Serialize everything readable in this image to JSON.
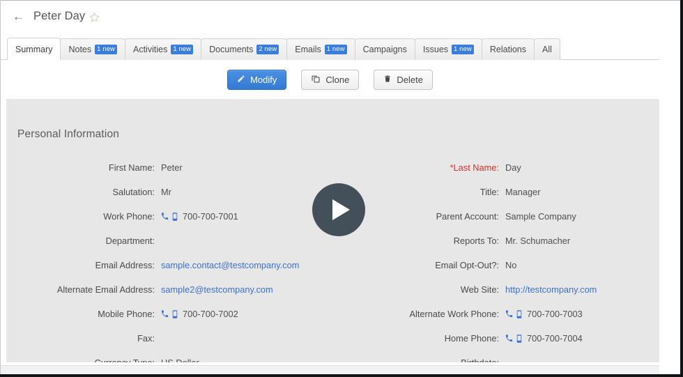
{
  "window": {
    "frame_color": "#111315",
    "background": "#ffffff"
  },
  "header": {
    "back_icon": "back-arrow-icon",
    "back_glyph": "←",
    "title": "Peter Day",
    "favorite_icon": "star-outline-icon",
    "star_color": "#d8cfc2"
  },
  "tabs": {
    "active": "Summary",
    "items": [
      {
        "label": "Summary",
        "badge": "",
        "active": true
      },
      {
        "label": "Notes",
        "badge": "1 new",
        "active": false
      },
      {
        "label": "Activities",
        "badge": "1 new",
        "active": false
      },
      {
        "label": "Documents",
        "badge": "2 new",
        "active": false
      },
      {
        "label": "Emails",
        "badge": "1 new",
        "active": false
      },
      {
        "label": "Campaigns",
        "badge": "",
        "active": false
      },
      {
        "label": "Issues",
        "badge": "1 new",
        "active": false
      },
      {
        "label": "Relations",
        "badge": "",
        "active": false
      },
      {
        "label": "All",
        "badge": "",
        "active": false
      }
    ],
    "badge_color": "#3b7ddd"
  },
  "actions": {
    "modify": {
      "label": "Modify",
      "icon": "pencil-icon",
      "style": "primary",
      "color": "#337ad4"
    },
    "clone": {
      "label": "Clone",
      "icon": "copy-icon",
      "style": "default"
    },
    "delete": {
      "label": "Delete",
      "icon": "trash-icon",
      "style": "default"
    }
  },
  "detail": {
    "section_title": "Personal Information",
    "panel_color": "#e7e7e7",
    "required_color": "#d93025",
    "link_color": "#3b6fd4",
    "rows": [
      {
        "left": {
          "label": "First Name:",
          "value": "Peter",
          "type": "text",
          "required": false
        },
        "right": {
          "label": "*Last Name:",
          "value": "Day",
          "type": "text",
          "required": true
        }
      },
      {
        "left": {
          "label": "Salutation:",
          "value": "Mr",
          "type": "text",
          "required": false
        },
        "right": {
          "label": "Title:",
          "value": "Manager",
          "type": "text",
          "required": false
        }
      },
      {
        "left": {
          "label": "Work Phone:",
          "value": "700-700-7001",
          "type": "phone",
          "required": false
        },
        "right": {
          "label": "Parent Account:",
          "value": "Sample Company",
          "type": "text",
          "required": false
        }
      },
      {
        "left": {
          "label": "Department:",
          "value": "",
          "type": "text",
          "required": false
        },
        "right": {
          "label": "Reports To:",
          "value": "Mr. Schumacher",
          "type": "text",
          "required": false
        }
      },
      {
        "left": {
          "label": "Email Address:",
          "value": "sample.contact@testcompany.com",
          "type": "link",
          "required": false
        },
        "right": {
          "label": "Email Opt-Out?:",
          "value": "No",
          "type": "text",
          "required": false
        }
      },
      {
        "left": {
          "label": "Alternate Email Address:",
          "value": "sample2@testcompany.com",
          "type": "link",
          "required": false
        },
        "right": {
          "label": "Web Site:",
          "value": "http://testcompany.com",
          "type": "link",
          "required": false
        }
      },
      {
        "left": {
          "label": "Mobile Phone:",
          "value": "700-700-7002",
          "type": "phone",
          "required": false
        },
        "right": {
          "label": "Alternate Work Phone:",
          "value": "700-700-7003",
          "type": "phone",
          "required": false
        }
      },
      {
        "left": {
          "label": "Fax:",
          "value": "",
          "type": "text",
          "required": false
        },
        "right": {
          "label": "Home Phone:",
          "value": "700-700-7004",
          "type": "phone",
          "required": false
        }
      },
      {
        "left": {
          "label": "Currency Type:",
          "value": "US Dollar",
          "type": "text",
          "required": false
        },
        "right": {
          "label": "Birthdate:",
          "value": "",
          "type": "text",
          "required": false
        }
      }
    ]
  },
  "overlay": {
    "play_icon": "play-triangle-icon",
    "circle_color": "#43505a",
    "triangle_color": "#ffffff"
  }
}
